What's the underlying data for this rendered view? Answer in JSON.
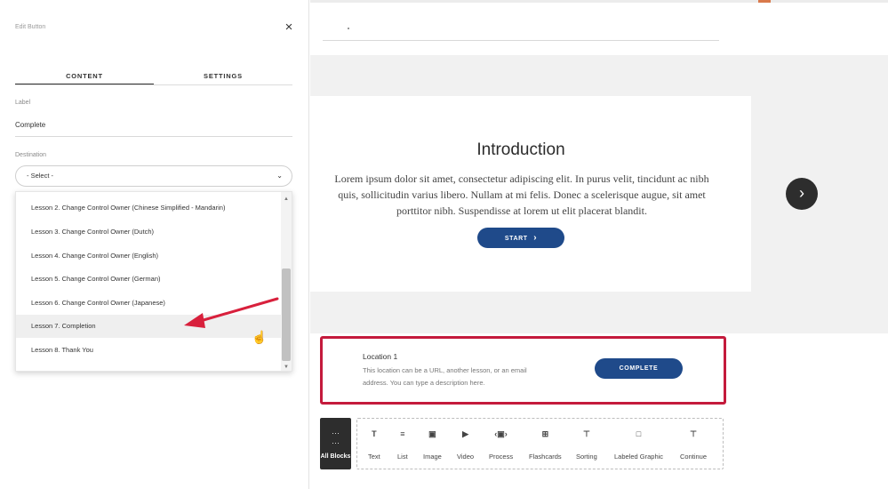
{
  "panel": {
    "title": "Edit Button",
    "close": "×",
    "tabs": [
      {
        "label": "CONTENT",
        "active": true
      },
      {
        "label": "SETTINGS",
        "active": false
      }
    ],
    "label_field": {
      "label": "Label",
      "value": "Complete"
    },
    "destination_field": {
      "label": "Destination",
      "selected": "- Select -"
    },
    "dropdown_options": [
      "Lesson 2. Change Control Owner (Chinese Simplified - Mandarin)",
      "Lesson 3. Change Control Owner (Dutch)",
      "Lesson 4. Change Control Owner (English)",
      "Lesson 5. Change Control Owner (German)",
      "Lesson 6. Change Control Owner (Japanese)",
      "Lesson 7. Completion",
      "Lesson 8. Thank You"
    ],
    "highlighted_option": "Lesson 7. Completion"
  },
  "lesson": {
    "title": "Introduction",
    "body": "Lorem ipsum dolor sit amet, consectetur adipiscing elit. In purus velit, tincidunt ac nibh quis, sollicitudin varius libero. Nullam at mi felis. Donec a scelerisque augue, sit amet porttitor nibh. Suspendisse at lorem ut elit placerat blandit.",
    "start_label": "START",
    "start_chevron": "›",
    "next_chevron": "›"
  },
  "location": {
    "title": "Location 1",
    "description": "This location can be a URL, another lesson, or an email address. You can type a description here.",
    "button_label": "COMPLETE"
  },
  "block_toolbar": {
    "all_blocks_label": "All Blocks",
    "blocks": [
      {
        "label": "Text",
        "icon": "text-icon"
      },
      {
        "label": "List",
        "icon": "list-icon"
      },
      {
        "label": "Image",
        "icon": "image-icon"
      },
      {
        "label": "Video",
        "icon": "video-icon"
      },
      {
        "label": "Process",
        "icon": "process-icon"
      },
      {
        "label": "Flashcards",
        "icon": "flashcards-icon"
      },
      {
        "label": "Sorting",
        "icon": "sorting-icon"
      },
      {
        "label": "Labeled Graphic",
        "icon": "labeled-graphic-icon"
      },
      {
        "label": "Continue",
        "icon": "continue-icon"
      }
    ]
  },
  "colors": {
    "accent_blue": "#1f4a8a",
    "highlight_red": "#c41a3c",
    "annotation_arrow": "#d8203c",
    "dark": "#2d2d2d"
  }
}
